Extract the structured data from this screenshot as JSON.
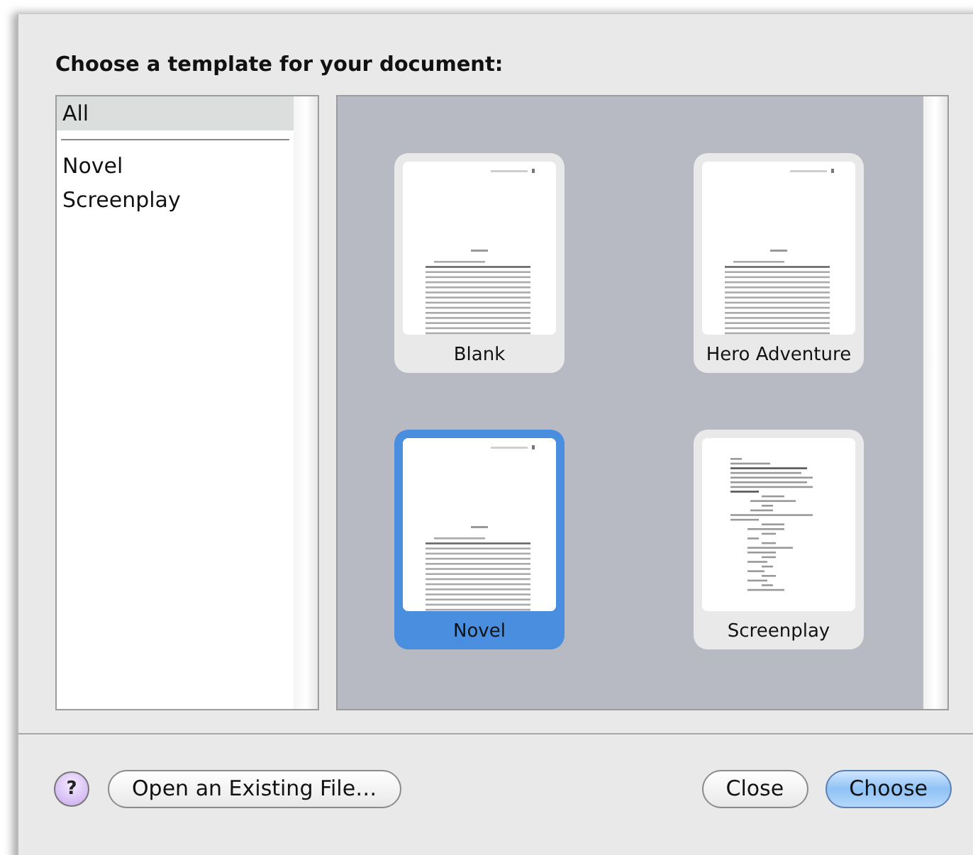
{
  "heading": "Choose a template for your document:",
  "categories": [
    {
      "label": "All",
      "selected": true
    },
    {
      "label": "Novel",
      "selected": false
    },
    {
      "label": "Screenplay",
      "selected": false
    }
  ],
  "templates": [
    {
      "label": "Blank",
      "kind": "prose",
      "selected": false
    },
    {
      "label": "Hero Adventure",
      "kind": "prose",
      "selected": false
    },
    {
      "label": "Novel",
      "kind": "prose",
      "selected": true
    },
    {
      "label": "Screenplay",
      "kind": "script",
      "selected": false
    }
  ],
  "help_button": "?",
  "buttons": [
    {
      "label": "Open an Existing File…",
      "kind": "plain"
    },
    {
      "label": "Close",
      "kind": "plain"
    },
    {
      "label": "Choose",
      "kind": "default"
    }
  ]
}
